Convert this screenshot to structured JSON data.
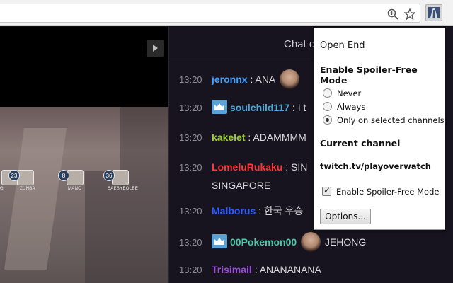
{
  "browser": {
    "icons": [
      "zoom-icon",
      "bookmark-star-icon",
      "open-end-extension-icon"
    ]
  },
  "video": {
    "heroes": [
      {
        "number": "",
        "name": "G"
      },
      {
        "number": "23",
        "name": "ZUNBA"
      },
      {
        "number": "8",
        "name": "MANO"
      },
      {
        "number": "36",
        "name": "SAEBYEOLBE"
      }
    ]
  },
  "chat": {
    "title": "Chat o",
    "messages": [
      {
        "time": "13:20",
        "user": "jeronnx",
        "color": "#3fa0ff",
        "badge": false,
        "pre_emote": false,
        "text": "ANA",
        "post_emote": true
      },
      {
        "time": "13:20",
        "user": "soulchild117",
        "color": "#4aa6d8",
        "badge": true,
        "pre_emote": false,
        "text": "I t",
        "post_emote": false
      },
      {
        "time": "13:20",
        "user": "kakelet",
        "color": "#9acd32",
        "badge": false,
        "pre_emote": false,
        "text": "ADAMMMM",
        "post_emote": false
      },
      {
        "time": "13:20",
        "user": "LomeluRukaku",
        "color": "#ff3838",
        "badge": false,
        "pre_emote": false,
        "text": "SIN",
        "post_emote": false
      },
      {
        "time": "",
        "user": "",
        "color": "#dad8de",
        "badge": false,
        "pre_emote": false,
        "text": "SINGAPORE",
        "post_emote": false
      },
      {
        "time": "13:20",
        "user": "Malborus",
        "color": "#2e5cff",
        "badge": false,
        "pre_emote": false,
        "text": "한국 우승",
        "post_emote": false
      },
      {
        "time": "13:20",
        "user": "00Pokemon00",
        "color": "#4ac7a8",
        "badge": true,
        "pre_emote": true,
        "text": "JEHONG",
        "post_emote": false
      },
      {
        "time": "13:20",
        "user": "Trisimail",
        "color": "#9b4de0",
        "badge": false,
        "pre_emote": false,
        "text": "ANANANANA",
        "post_emote": false
      }
    ]
  },
  "popup": {
    "title": "Open End",
    "mode_heading": "Enable Spoiler-Free Mode",
    "options": [
      {
        "label": "Never",
        "selected": false
      },
      {
        "label": "Always",
        "selected": false
      },
      {
        "label": "Only on selected channels",
        "selected": true
      }
    ],
    "channel_heading": "Current channel",
    "channel": "twitch.tv/playoverwatch",
    "enable_label": "Enable Spoiler-Free Mode",
    "enable_checked": true,
    "options_button": "Options..."
  }
}
